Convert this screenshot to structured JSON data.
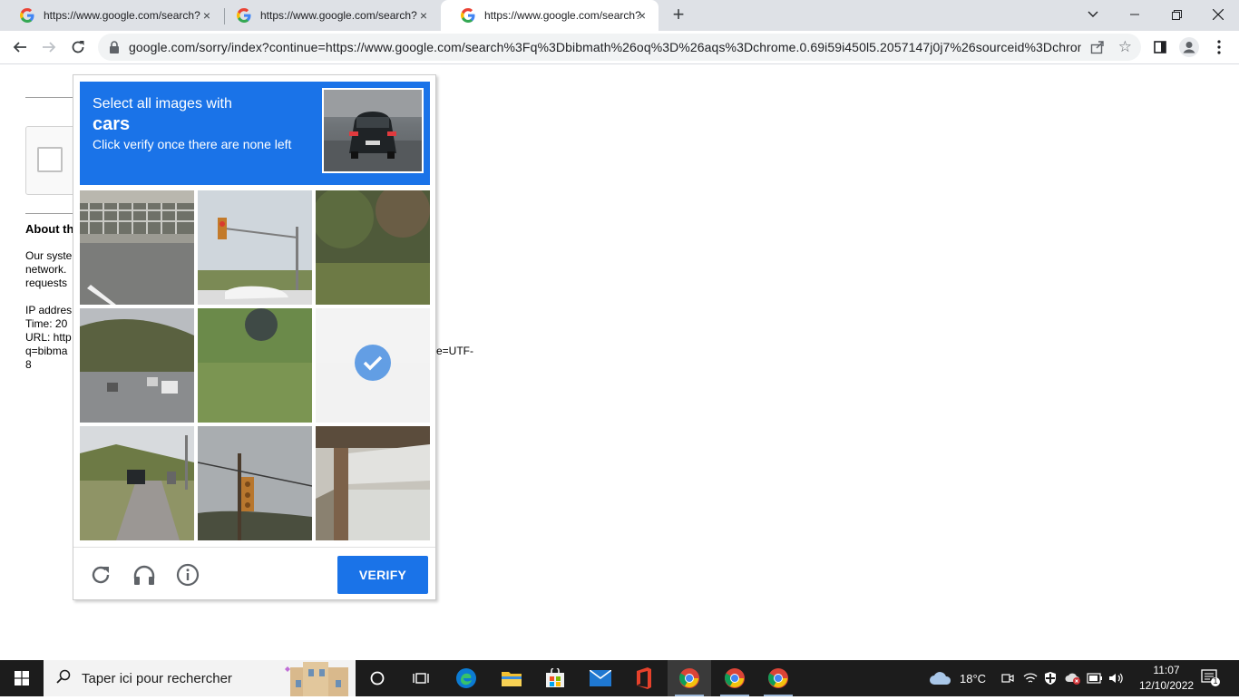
{
  "tabs": [
    {
      "title": "https://www.google.com/search?",
      "close": "×"
    },
    {
      "title": "https://www.google.com/search?",
      "close": "×"
    },
    {
      "title": "https://www.google.com/search?",
      "close": "×"
    }
  ],
  "new_tab": "+",
  "address_bar": {
    "url": "google.com/sorry/index?continue=https://www.google.com/search%3Fq%3Dbibmath%26oq%3D%26aqs%3Dchrome.0.69i59i450l5.2057147j0j7%26sourceid%3Dchrom..."
  },
  "page": {
    "about_heading": "About th",
    "para1": "Our syste\nnetwork.\nrequests",
    "para2": "IP addres\nTime: 20\nURL: http\nq=bibma\n8",
    "para2_tail": "e=UTF-"
  },
  "captcha": {
    "instruction_line1": "Select all images with",
    "target_object": "cars",
    "instruction_line3": "Click verify once there are none left",
    "verify_label": "VERIFY",
    "selected_tile_index": 5,
    "tiles": [
      "bridge-road",
      "traffic-light",
      "grass",
      "street-cars",
      "grass-tree",
      "selected",
      "road-car",
      "traffic-light-pole",
      "overpass"
    ]
  },
  "taskbar": {
    "search_placeholder": "Taper ici pour rechercher",
    "weather": "18°C",
    "time": "11:07",
    "date": "12/10/2022",
    "notification_count": "1"
  },
  "colors": {
    "accent": "#1a73e8",
    "tabstrip": "#dee1e6",
    "taskbar": "#1c1c1c"
  }
}
